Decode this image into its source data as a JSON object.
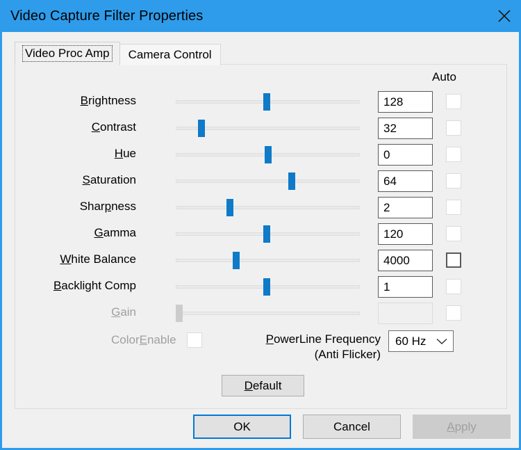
{
  "window": {
    "title": "Video Capture Filter Properties",
    "close_icon": "close-icon",
    "titlebar_color": "#2e9ceb",
    "background_color": "#f0f0f0"
  },
  "tabs": [
    {
      "label": "Video Proc Amp",
      "selected": true
    },
    {
      "label": "Camera Control",
      "selected": false
    }
  ],
  "panel": {
    "auto_column_header": "Auto",
    "rows": [
      {
        "label_pre": "",
        "label_mnemonic": "B",
        "label_post": "rightness",
        "value": "128",
        "slider_percent": 49.6,
        "auto_checked": false,
        "auto_enabled": false,
        "enabled": true
      },
      {
        "label_pre": "",
        "label_mnemonic": "C",
        "label_post": "ontrast",
        "value": "32",
        "slider_percent": 14.0,
        "auto_checked": false,
        "auto_enabled": false,
        "enabled": true
      },
      {
        "label_pre": "",
        "label_mnemonic": "H",
        "label_post": "ue",
        "value": "0",
        "slider_percent": 50.0,
        "auto_checked": false,
        "auto_enabled": false,
        "enabled": true
      },
      {
        "label_pre": "",
        "label_mnemonic": "S",
        "label_post": "aturation",
        "value": "64",
        "slider_percent": 62.9,
        "auto_checked": false,
        "auto_enabled": false,
        "enabled": true
      },
      {
        "label_pre": "Shar",
        "label_mnemonic": "p",
        "label_post": "ness",
        "value": "2",
        "slider_percent": 29.6,
        "auto_checked": false,
        "auto_enabled": false,
        "enabled": true
      },
      {
        "label_pre": "",
        "label_mnemonic": "G",
        "label_post": "amma",
        "value": "120",
        "slider_percent": 49.6,
        "auto_checked": false,
        "auto_enabled": false,
        "enabled": true
      },
      {
        "label_pre": "",
        "label_mnemonic": "W",
        "label_post": "hite Balance",
        "value": "4000",
        "slider_percent": 32.8,
        "auto_checked": false,
        "auto_enabled": true,
        "enabled": true
      },
      {
        "label_pre": "",
        "label_mnemonic": "B",
        "label_post": "acklight Comp",
        "value": "1",
        "slider_percent": 49.6,
        "auto_checked": false,
        "auto_enabled": false,
        "enabled": true
      },
      {
        "label_pre": "",
        "label_mnemonic": "G",
        "label_post": "ain",
        "value": "",
        "slider_percent": 2.0,
        "auto_checked": false,
        "auto_enabled": false,
        "enabled": false
      }
    ],
    "color_enable": {
      "label_pre": "Color",
      "label_mnemonic": "E",
      "label_post": "nable",
      "checked": false,
      "enabled": false
    },
    "powerline": {
      "label_mnemonic": "P",
      "label_line1_post": "owerLine Frequency",
      "label_line2": "(Anti Flicker)",
      "selected_option": "60 Hz",
      "options": [
        "60 Hz"
      ],
      "chevron_icon": "chevron-down-icon"
    },
    "default_button": {
      "label_pre": "",
      "label_mnemonic": "D",
      "label_post": "efault"
    }
  },
  "footer": {
    "ok": {
      "label": "OK",
      "default": true,
      "enabled": true
    },
    "cancel": {
      "label": "Cancel",
      "enabled": true
    },
    "apply": {
      "label_pre": "",
      "label_mnemonic": "A",
      "label_post": "pply",
      "enabled": false
    }
  }
}
